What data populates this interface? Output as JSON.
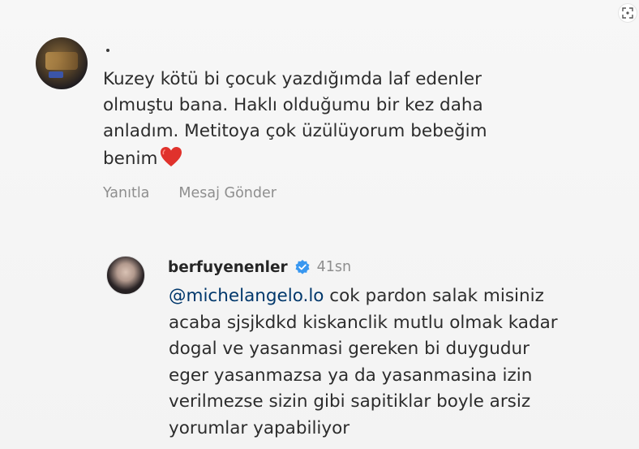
{
  "comment1": {
    "text": "Kuzey kötü bi çocuk yazdığımda laf edenler\nolmuştu bana. Haklı olduğumu bir kez daha\nanladım. Metitoya çok üzülüyorum bebeğim\nbenim",
    "heart": "❤️",
    "actions": {
      "reply": "Yanıtla",
      "send_message": "Mesaj Gönder"
    }
  },
  "comment2": {
    "username": "berfuyenenler",
    "time": "41sn",
    "mention": "@michelangelo.lo",
    "text": " cok pardon salak misiniz\nacaba sjsjkdkd kiskanclik mutlu olmak kadar\ndogal ve yasanmasi gereken bi duygudur\neger yasanmazsa ya da yasanmasina izin\nverilmezse sizin gibi sapitiklar boyle arsiz\nyorumlar yapabiliyor"
  },
  "colors": {
    "verified": "#3897f0",
    "heart": "#e0322c",
    "mention": "#00376b",
    "muted": "#8e8e8e"
  },
  "icons": [
    "expand-icon",
    "verified-icon",
    "heart-icon"
  ]
}
